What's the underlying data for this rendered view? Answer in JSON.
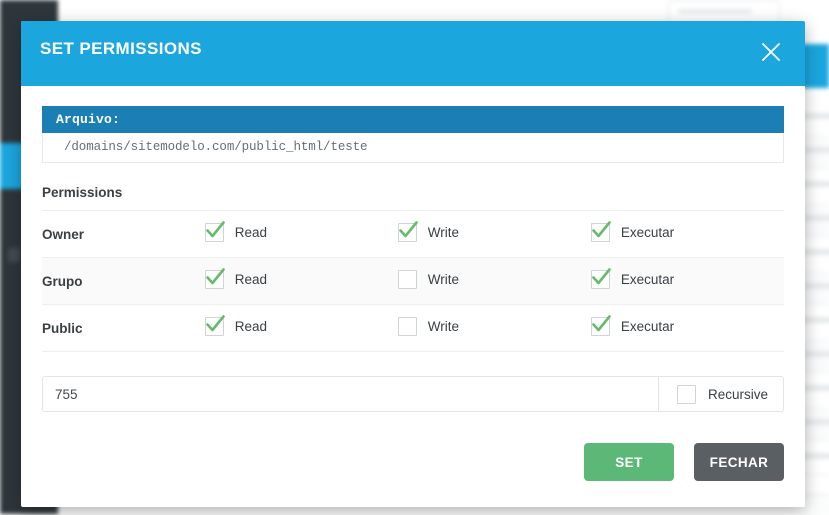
{
  "modal": {
    "title": "SET PERMISSIONS",
    "close_icon": "close-icon",
    "file": {
      "label": "Arquivo:",
      "path": "/domains/sitemodelo.com/public_html/teste"
    },
    "permissions_heading": "Permissions",
    "rows": [
      {
        "role": "Owner",
        "perms": [
          {
            "label": "Read",
            "checked": true
          },
          {
            "label": "Write",
            "checked": true
          },
          {
            "label": "Executar",
            "checked": true
          }
        ]
      },
      {
        "role": "Grupo",
        "perms": [
          {
            "label": "Read",
            "checked": true
          },
          {
            "label": "Write",
            "checked": false
          },
          {
            "label": "Executar",
            "checked": true
          }
        ]
      },
      {
        "role": "Public",
        "perms": [
          {
            "label": "Read",
            "checked": true
          },
          {
            "label": "Write",
            "checked": false
          },
          {
            "label": "Executar",
            "checked": true
          }
        ]
      }
    ],
    "mode": {
      "value": "755",
      "placeholder": "",
      "recursive_label": "Recursive",
      "recursive_checked": false
    },
    "buttons": {
      "set": "SET",
      "close": "FECHAR"
    }
  },
  "colors": {
    "header_blue": "#1ba6de",
    "file_label_blue": "#1b7fb5",
    "check_green": "#66bb6a",
    "set_green": "#5cb877",
    "close_gray": "#5a5f63",
    "sidebar_dark": "#2f363b"
  }
}
